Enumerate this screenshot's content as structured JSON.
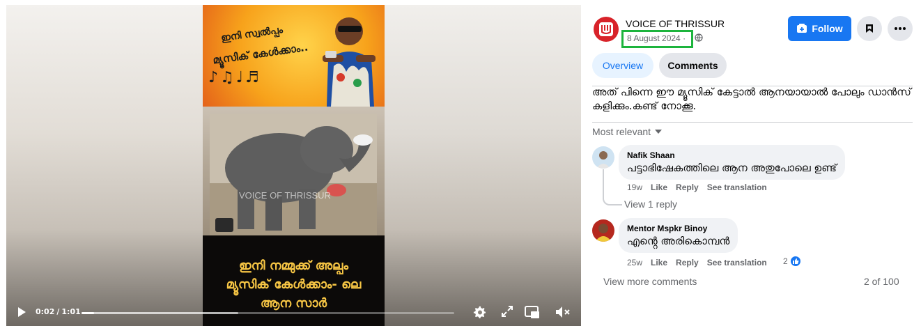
{
  "video": {
    "thumbnail_line1": "ഇനി സ്വൽപ്പം",
    "thumbnail_line2": "മ്യൂസിക് കേൾക്കാം..",
    "watermark": "VOICE OF THRISSUR",
    "caption_line1": "ഇനി നമ്മുക്ക് അല്പം",
    "caption_line2": "മ്യൂസിക് കേൾക്കാം- ലെ",
    "caption_line3": "ആന സാർ",
    "current_time": "0:02",
    "duration": "1:01",
    "progress_fraction": 0.033,
    "buffered_fraction": 0.42,
    "controls": {
      "play": "play-icon",
      "settings": "gear-icon",
      "fullscreen": "expand-icon",
      "pip": "picture-in-picture-icon",
      "mute": "muted-speaker-icon"
    }
  },
  "post": {
    "page_name": "VOICE OF THRISSUR",
    "date": "8 August 2024",
    "date_separator": "·",
    "privacy_icon": "globe-icon",
    "follow_label": "Follow",
    "description": "അത് പിന്നെ ഈ മ്യൂസിക് കേട്ടാൽ ആനയായാൽ പോലും ഡാൻസ് കളിക്കും.കണ്ട് നോക്കൂ."
  },
  "tabs": [
    {
      "label": "Overview",
      "active": false
    },
    {
      "label": "Comments",
      "active": true
    }
  ],
  "comments_section": {
    "sort_label": "Most relevant",
    "comments": [
      {
        "author": "Nafik Shaan",
        "text": "പട്ടാഭിഷേകത്തിലെ ആന അതുപോലെ ഉണ്ട്",
        "age": "19w",
        "like_label": "Like",
        "reply_label": "Reply",
        "translate_label": "See translation",
        "view_replies": "View 1 reply"
      },
      {
        "author": "Mentor Mspkr Binoy",
        "text": "എൻ്റെ അരികൊമ്പൻ",
        "age": "25w",
        "like_label": "Like",
        "reply_label": "Reply",
        "translate_label": "See translation",
        "reaction_count": "2"
      }
    ],
    "view_more_label": "View more comments",
    "count_label": "2 of 100"
  },
  "colors": {
    "accent": "#1877f2",
    "highlight_box": "#1db43d",
    "brand_red": "#d8232a"
  }
}
